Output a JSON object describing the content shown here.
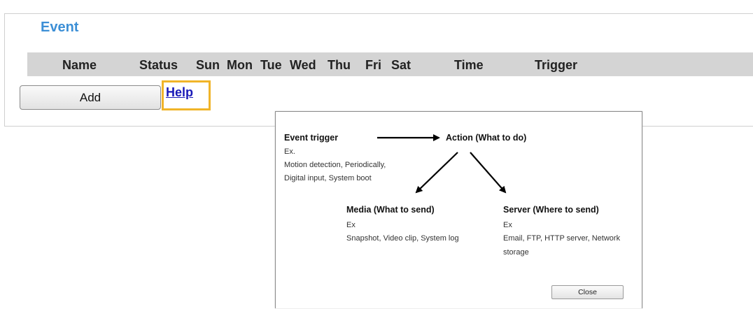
{
  "section": {
    "legend": "Event"
  },
  "table": {
    "columns": [
      "Name",
      "Status",
      "Sun",
      "Mon",
      "Tue",
      "Wed",
      "Thu",
      "Fri",
      "Sat",
      "Time",
      "Trigger"
    ]
  },
  "actions": {
    "add_label": "Add",
    "help_label": "Help"
  },
  "help_dialog": {
    "trigger_title": "Event trigger",
    "trigger_ex": "Ex.",
    "trigger_line1": "Motion detection, Periodically,",
    "trigger_line2": "Digital input, System boot",
    "action_title": "Action (What to do)",
    "media_title": "Media (What to send)",
    "media_ex": "Ex",
    "media_line1": "Snapshot, Video clip, System log",
    "server_title": "Server (Where to send)",
    "server_ex": "Ex",
    "server_line1": "Email, FTP, HTTP server, Network",
    "server_line2": "storage",
    "close_label": "Close"
  },
  "colors": {
    "legend": "#3c8fd6",
    "help_highlight": "#f0b429",
    "link": "#1a1ab8",
    "header_bar": "#d4d4d4"
  }
}
